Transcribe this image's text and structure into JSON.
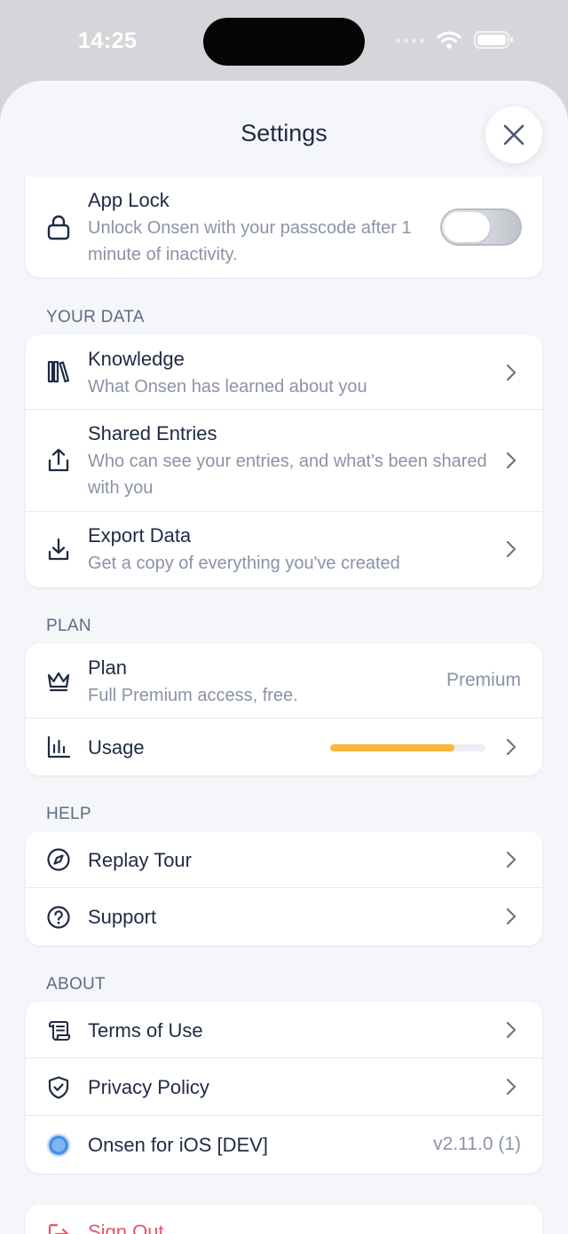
{
  "status_bar": {
    "time": "14:25"
  },
  "sheet": {
    "title": "Settings"
  },
  "app_lock": {
    "title": "App Lock",
    "subtitle": "Unlock Onsen with your passcode after 1 minute of inactivity.",
    "enabled": false
  },
  "sections": {
    "your_data": "YOUR DATA",
    "plan": "PLAN",
    "help": "HELP",
    "about": "ABOUT"
  },
  "your_data": {
    "knowledge": {
      "title": "Knowledge",
      "subtitle": "What Onsen has learned about you",
      "icon": "books-icon"
    },
    "shared": {
      "title": "Shared Entries",
      "subtitle": "Who can see your entries, and what's been shared with you",
      "icon": "share-icon"
    },
    "export": {
      "title": "Export Data",
      "subtitle": "Get a copy of everything you've created",
      "icon": "download-icon"
    }
  },
  "plan": {
    "plan_row": {
      "title": "Plan",
      "subtitle": "Full Premium access, free.",
      "value": "Premium",
      "icon": "crown-icon"
    },
    "usage_row": {
      "title": "Usage",
      "progress": 0.8,
      "icon": "bar-chart-icon"
    }
  },
  "help": {
    "tour": {
      "title": "Replay Tour",
      "icon": "compass-icon"
    },
    "support": {
      "title": "Support",
      "icon": "help-circle-icon"
    }
  },
  "about": {
    "terms": {
      "title": "Terms of Use",
      "icon": "scroll-icon"
    },
    "privacy": {
      "title": "Privacy Policy",
      "icon": "shield-check-icon"
    },
    "app": {
      "title": "Onsen for iOS [DEV]",
      "value": "v2.11.0 (1)",
      "icon": "onsen-logo-icon"
    }
  },
  "sign_out": {
    "title": "Sign Out",
    "icon": "logout-icon"
  },
  "colors": {
    "accent": "#fbb73a",
    "danger": "#e5566b",
    "text": "#1f2a44",
    "muted": "#8a93a6",
    "logo": "#4a90e2"
  }
}
